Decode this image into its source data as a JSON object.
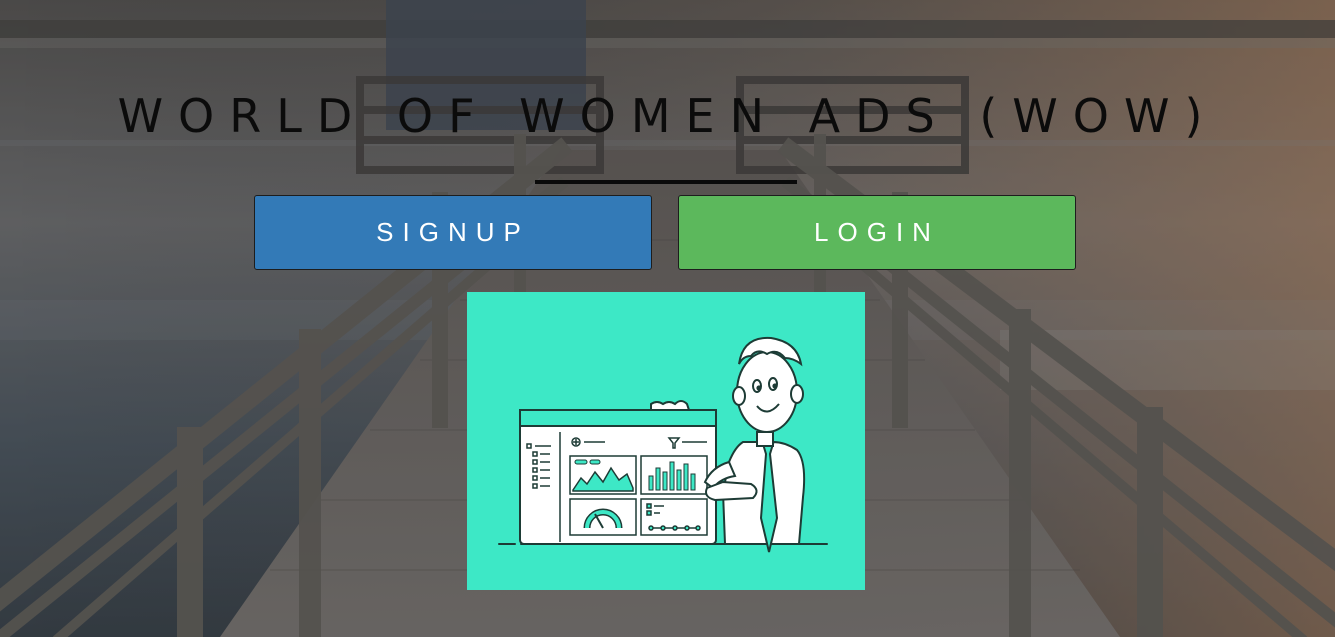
{
  "hero": {
    "title": "WORLD OF WOMEN ADS (WOW)",
    "background": "pier-over-lake-photo"
  },
  "actions": {
    "signup_label": "SIGNUP",
    "login_label": "LOGIN"
  },
  "illustration": {
    "subject": "man-presenting-analytics-dashboard-illustration"
  },
  "colors": {
    "signup": "#337ab7",
    "login": "#5cb85c",
    "illustration_bg": "#3de8c6",
    "title": "#0b0b0b"
  }
}
